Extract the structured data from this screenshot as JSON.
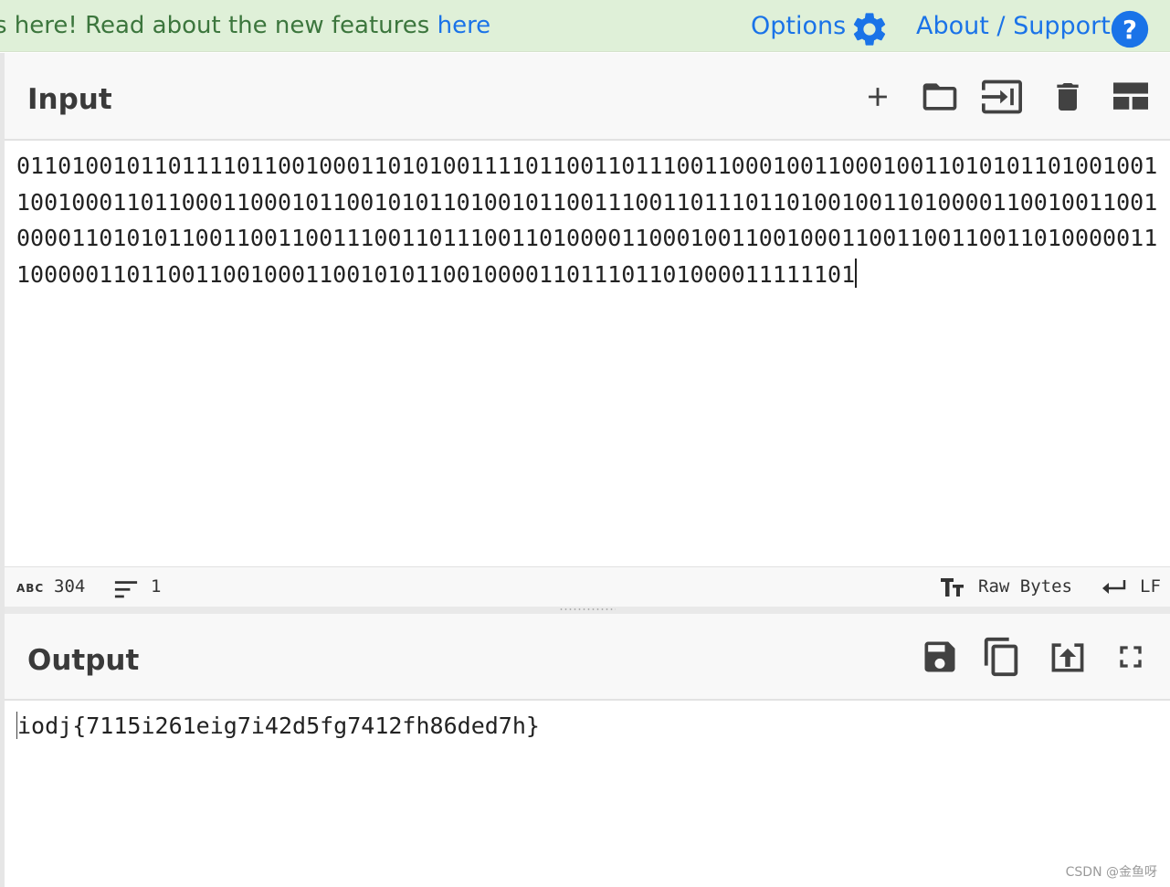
{
  "banner": {
    "message": "s here! Read about the new features ",
    "link": "here",
    "options_label": "Options",
    "about_label": "About / Support",
    "options_icon": "gear-icon",
    "about_icon": "help-circle-icon"
  },
  "input": {
    "title": "Input",
    "text": "0110100101101111011001000110101001111011001101110011000100110001001101010110100100110010001101100011000101100101011010010110011100110111011010010011010000110010011001000011010101100110011001110011011100110100001100010011001000110011001100110100000111000001101100110010001100101011001000011011101101000011111101",
    "tools": [
      "add-icon",
      "folder-open-icon",
      "import-file-icon",
      "delete-icon",
      "layout-icon"
    ]
  },
  "status": {
    "length_label": "ABC",
    "length": "304",
    "lines": "1",
    "encoding": "Raw Bytes",
    "eol": "LF"
  },
  "output": {
    "title": "Output",
    "text": "iodj{7115i261eig7i42d5fg7412fh86ded7h}",
    "tools": [
      "save-icon",
      "copy-icon",
      "replace-input-icon",
      "fullscreen-icon"
    ]
  },
  "colors": {
    "banner_bg": "#dff0d8",
    "banner_text": "#3c763d",
    "link": "#1a73e8",
    "icon": "#424242"
  },
  "watermark": "CSDN @金鱼呀"
}
